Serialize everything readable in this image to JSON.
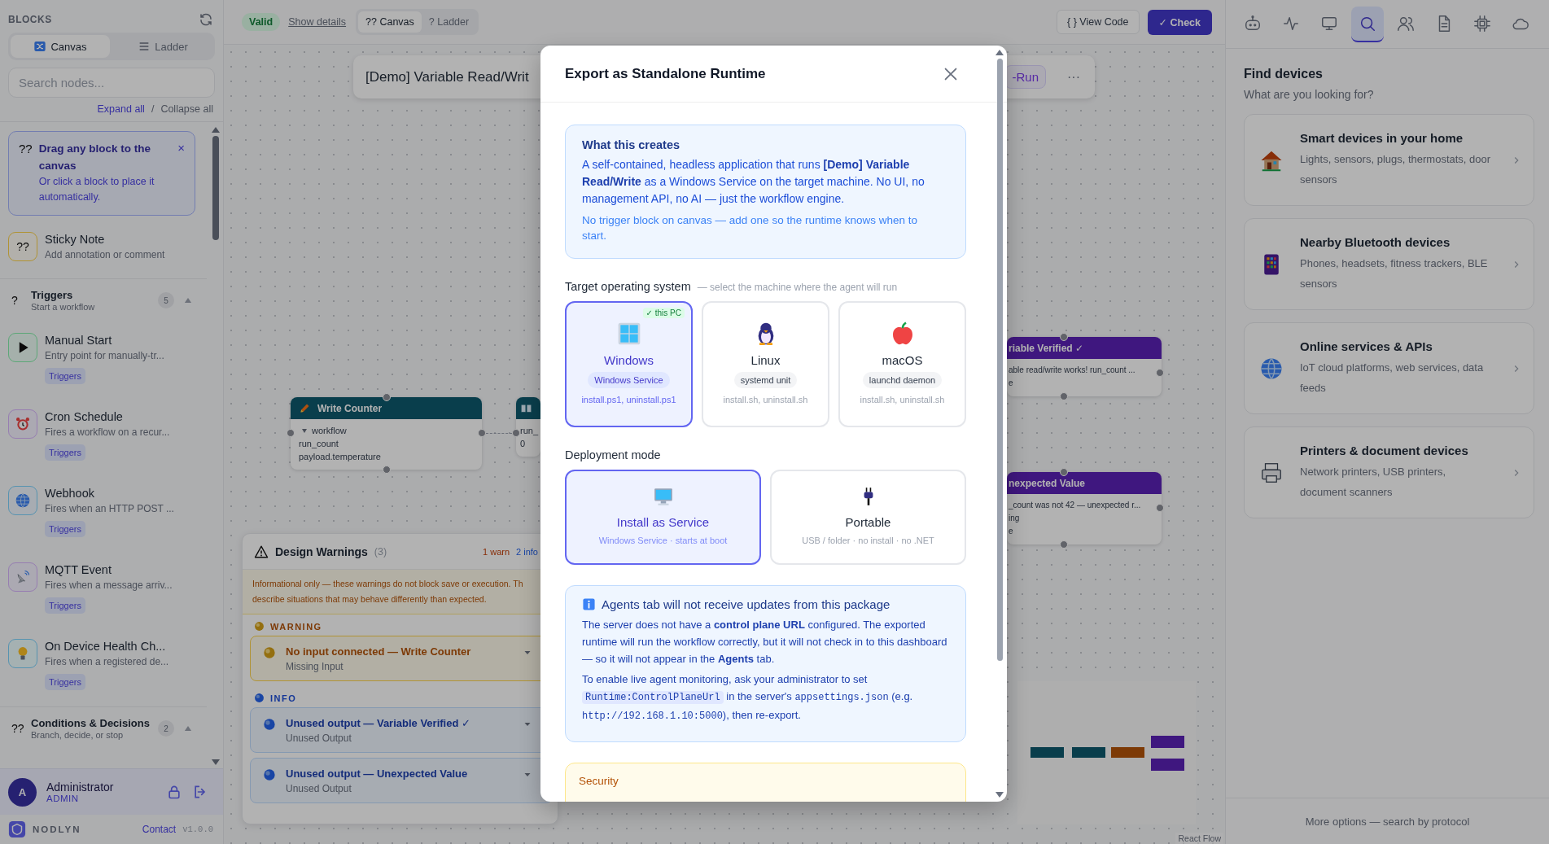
{
  "sidebar": {
    "title": "BLOCKS",
    "view_toggle": [
      {
        "kind": "canvas",
        "label": "Canvas",
        "selected": true
      },
      {
        "kind": "ladder",
        "label": "Ladder",
        "selected": false
      }
    ],
    "search": {
      "placeholder": "Search nodes..."
    },
    "expand_label": "Expand all",
    "separator": "/",
    "collapse_label": "Collapse all",
    "tip": {
      "glyph": "??",
      "title": "Drag any block to the canvas",
      "text": "Or click a block to place it automatically.",
      "close": "×"
    },
    "sticky": {
      "glyph": "??",
      "title": "Sticky Note",
      "description": "Add annotation or comment"
    },
    "groups": [
      {
        "glyph": "?",
        "title": "Triggers",
        "subtitle": "Start a workflow",
        "count": "5",
        "expanded": true,
        "items": [
          {
            "kind": "play",
            "title": "Manual Start",
            "description": "Entry point for manually-tr...",
            "tag": "Triggers"
          },
          {
            "kind": "alarm",
            "title": "Cron Schedule",
            "description": "Fires a workflow on a recur...",
            "tag": "Triggers"
          },
          {
            "kind": "globe",
            "title": "Webhook",
            "description": "Fires when an HTTP POST ...",
            "tag": "Triggers"
          },
          {
            "kind": "satellite",
            "title": "MQTT Event",
            "description": "Fires when a message arriv...",
            "tag": "Triggers"
          },
          {
            "kind": "bulb",
            "title": "On Device Health Ch...",
            "description": "Fires when a registered de...",
            "tag": "Triggers"
          }
        ]
      },
      {
        "glyph": "??",
        "title": "Conditions & Decisions",
        "subtitle": "Branch, decide, or stop",
        "count": "2",
        "expanded": true
      }
    ],
    "user": {
      "initial": "A",
      "name": "Administrator",
      "role": "ADMIN"
    },
    "brand": "NODLYN",
    "contact": "Contact",
    "version": "v1.0.0"
  },
  "topbar": {
    "status": "Valid",
    "details_link": "Show details",
    "view_tabs": [
      {
        "label": "?? Canvas",
        "selected": true
      },
      {
        "label": "? Ladder",
        "selected": false
      }
    ],
    "view_code": "{ } View Code",
    "check": "✓ Check"
  },
  "canvas": {
    "title": "[Demo] Variable Read/Writ",
    "run_label": "-Run",
    "more": "···",
    "nodes": [
      {
        "kind": "write",
        "title": "Write Counter",
        "rows": [
          "workflow",
          "run_count",
          "payload.temperature"
        ]
      },
      {
        "kind": "read",
        "rows": [
          "run_",
          "0"
        ]
      },
      {
        "kind": "check",
        "title": "riable Verified ✓",
        "rows": [
          "able read/write works! run_count ...",
          "e"
        ]
      },
      {
        "kind": "check",
        "title": "nexpected Value",
        "rows": [
          "_count was not 42 — unexpected r...",
          "ing",
          "e"
        ]
      }
    ],
    "attribution": "React Flow",
    "warnings": {
      "title": "Design Warnings",
      "count": "(3)",
      "warn_summary": "1 warn",
      "info_summary": "2 info",
      "note_lines": [
        "Informational only — these warnings do not block save or execution. Th",
        "describe situations that may behave differently than expected."
      ],
      "sections": [
        {
          "kind": "warning",
          "label": "WARNING",
          "items": [
            {
              "title": "No input connected — Write Counter",
              "subtitle": "Missing Input"
            }
          ]
        },
        {
          "kind": "info",
          "label": "INFO",
          "items": [
            {
              "title": "Unused output — Variable Verified ✓",
              "subtitle": "Unused Output"
            },
            {
              "title": "Unused output — Unexpected Value",
              "subtitle": "Unused Output"
            }
          ]
        }
      ]
    }
  },
  "modal": {
    "title": "Export as Standalone Runtime",
    "about": {
      "title": "What this creates",
      "text": "A self-contained, headless application that runs **[Demo] Variable Read/Write** as a Windows Service on the target machine. No UI, no management API, no AI — just the workflow engine.",
      "note": "No trigger block on canvas — add one so the runtime knows when to start."
    },
    "os_section": {
      "title": "Target operating system",
      "hint": "— select the machine where the agent will run",
      "options": [
        {
          "kind": "windows",
          "name": "Windows",
          "badge": "✓ this PC",
          "tag": "Windows Service",
          "files": "install.ps1, uninstall.ps1",
          "selected": true
        },
        {
          "kind": "linux",
          "name": "Linux",
          "tag": "systemd unit",
          "files": "install.sh, uninstall.sh",
          "selected": false
        },
        {
          "kind": "macos",
          "name": "macOS",
          "tag": "launchd daemon",
          "files": "install.sh, uninstall.sh",
          "selected": false
        }
      ]
    },
    "mode_section": {
      "title": "Deployment mode",
      "options": [
        {
          "kind": "service",
          "name": "Install as Service",
          "detail": "Windows Service · starts at boot",
          "selected": true
        },
        {
          "kind": "portable",
          "name": "Portable",
          "detail": "USB / folder · no install · no .NET",
          "selected": false
        }
      ]
    },
    "agents_notice": {
      "title": "Agents tab will not receive updates from this package",
      "text": "The server does not have a **control plane URL** configured. The exported runtime will run the workflow correctly, but it will not check in to this dashboard — so it will not appear in the **Agents** tab.",
      "segments": [
        {
          "kind": "plain",
          "text": "To enable live agent monitoring, ask your administrator to set "
        },
        {
          "kind": "code",
          "text": "Runtime:ControlPlaneUrl"
        },
        {
          "kind": "plain",
          "text": " in the server's "
        },
        {
          "kind": "mono",
          "text": "appsettings.json"
        },
        {
          "kind": "plain",
          "text": " (e.g. "
        },
        {
          "kind": "mono",
          "text": "http://192.168.1.10:5000"
        },
        {
          "kind": "plain",
          "text": "), then re-export."
        }
      ]
    },
    "security": {
      "title": "Security"
    }
  },
  "right_panel": {
    "tabs": [
      {
        "kind": "robot",
        "selected": false
      },
      {
        "kind": "activity",
        "selected": false
      },
      {
        "kind": "monitor",
        "selected": false
      },
      {
        "kind": "search",
        "selected": true
      },
      {
        "kind": "users",
        "selected": false
      },
      {
        "kind": "file",
        "selected": false
      },
      {
        "kind": "chip",
        "selected": false
      },
      {
        "kind": "cloud",
        "selected": false
      }
    ],
    "title": "Find devices",
    "subtitle": "What are you looking for?",
    "categories": [
      {
        "kind": "home",
        "title": "Smart devices in your home",
        "description": "Lights, sensors, plugs, thermostats, door sensors"
      },
      {
        "kind": "phone",
        "title": "Nearby Bluetooth devices",
        "description": "Phones, headsets, fitness trackers, BLE sensors"
      },
      {
        "kind": "globe",
        "title": "Online services & APIs",
        "description": "IoT cloud platforms, web services, data feeds"
      },
      {
        "kind": "printer",
        "title": "Printers & document devices",
        "description": "Network printers, USB printers, document scanners"
      }
    ],
    "footer": "More options — search by protocol"
  }
}
